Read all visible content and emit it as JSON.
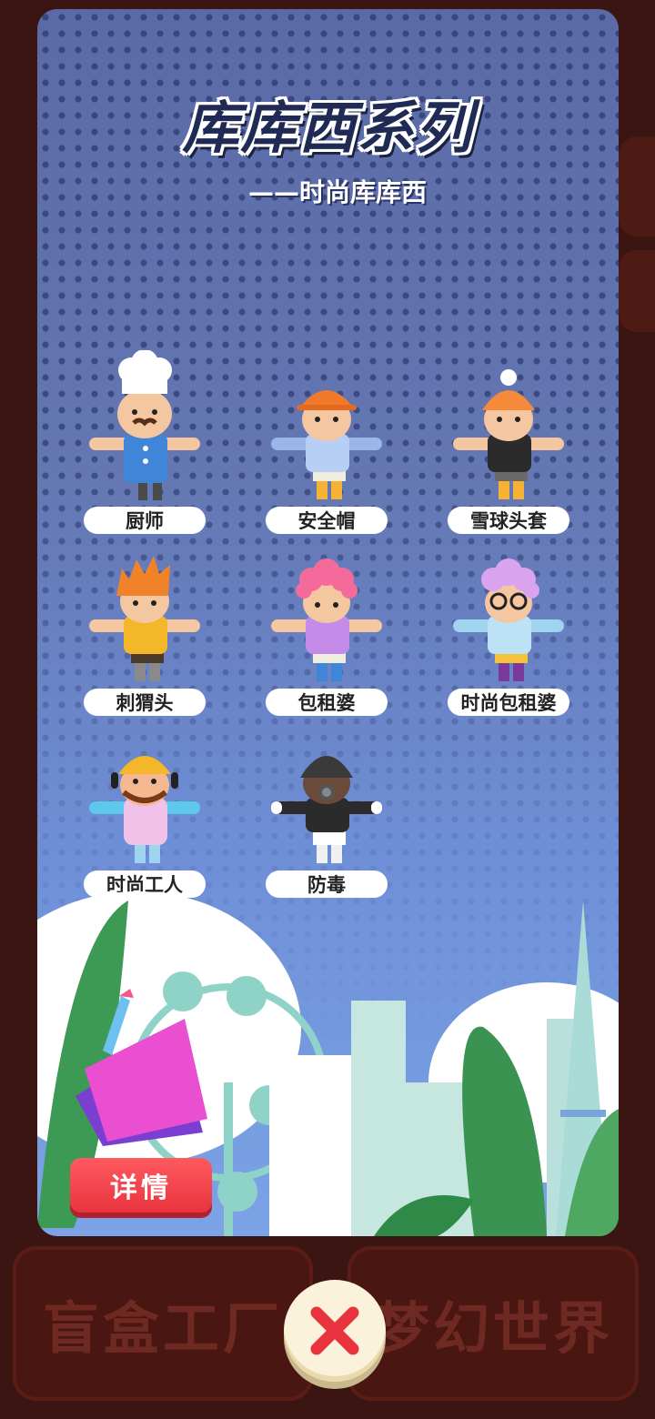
{
  "card": {
    "title": "库库西系列",
    "subtitle": "——时尚库库西"
  },
  "figures": [
    {
      "name": "厨师"
    },
    {
      "name": "安全帽"
    },
    {
      "name": "雪球头套"
    },
    {
      "name": "刺猬头"
    },
    {
      "name": "包租婆"
    },
    {
      "name": "时尚包租婆"
    },
    {
      "name": "时尚工人"
    },
    {
      "name": "防毒"
    }
  ],
  "buttons": {
    "detail": "详情",
    "close_icon": "close-x-icon"
  },
  "background": {
    "left_button": "盲盒工厂",
    "right_button": "梦幻世界"
  },
  "colors": {
    "card_top": "#5a6aa6",
    "card_bottom": "#7ba3e6",
    "detail_button": "#e8343e",
    "close_button": "#fbf2dc",
    "close_x": "#e8343e"
  }
}
